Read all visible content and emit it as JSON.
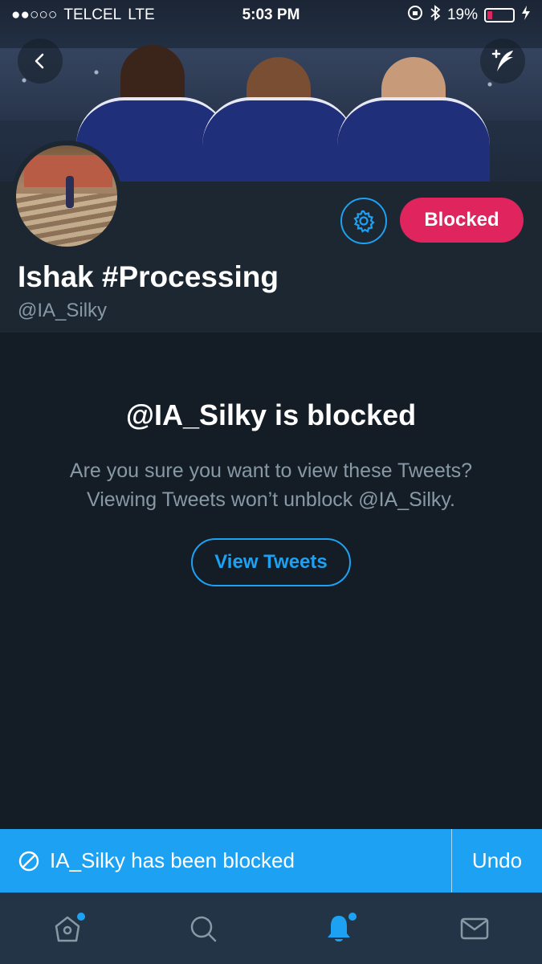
{
  "status_bar": {
    "carrier": "TELCEL",
    "network": "LTE",
    "time": "5:03 PM",
    "battery": "19%"
  },
  "profile": {
    "display_name": "Ishak #Processing",
    "handle": "@IA_Silky",
    "blocked_label": "Blocked"
  },
  "blocked_notice": {
    "title": "@IA_Silky is blocked",
    "line1": "Are you sure you want to view these Tweets?",
    "line2": "Viewing Tweets won’t unblock @IA_Silky.",
    "view_button": "View Tweets"
  },
  "toast": {
    "message": "IA_Silky has been blocked",
    "undo": "Undo"
  },
  "tabs": [
    {
      "icon": "home-icon",
      "active": false,
      "dot": true
    },
    {
      "icon": "search-icon",
      "active": false,
      "dot": false
    },
    {
      "icon": "notifications-icon",
      "active": true,
      "dot": true
    },
    {
      "icon": "messages-icon",
      "active": false,
      "dot": false
    }
  ],
  "colors": {
    "accent": "#1da1f2",
    "blocked": "#e0245e",
    "background": "#141d26",
    "panel": "#1c2732",
    "muted_text": "#8899a6"
  }
}
